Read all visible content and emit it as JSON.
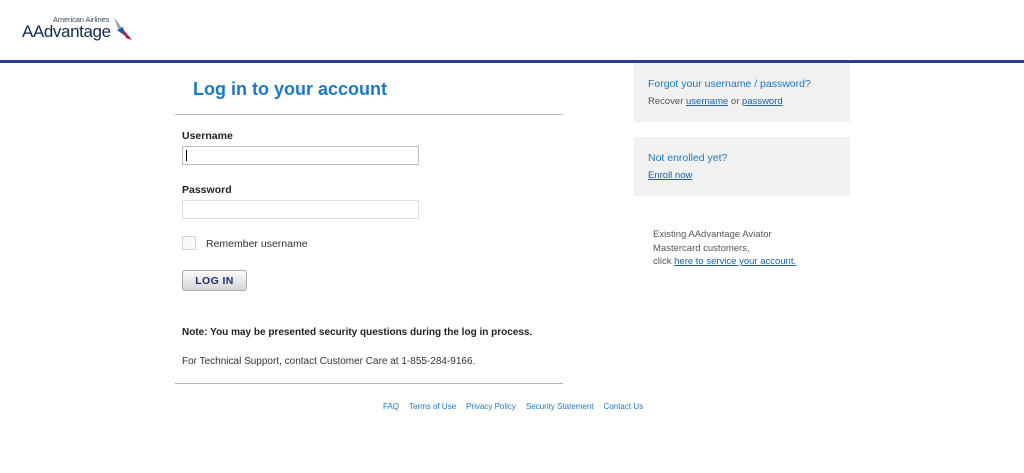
{
  "header": {
    "logo_small": "American Airlines",
    "logo_main": "AAdvantage",
    "colors": {
      "brand_navy": "#0f2a52",
      "bar": "#2b3c8d",
      "accent_red": "#c8102e",
      "accent_blue": "#1a79c7"
    }
  },
  "login": {
    "title": "Log in to your account",
    "username_label": "Username",
    "username_value": "",
    "password_label": "Password",
    "password_value": "",
    "remember_label": "Remember username",
    "remember_checked": false,
    "button_label": "LOG IN",
    "note": "Note: You may be presented security questions during the log in process.",
    "support": "For Technical Support, contact Customer Care at 1-855-284-9166."
  },
  "sidebar": {
    "forgot": {
      "title": "Forgot your username / password?",
      "prefix": "Recover ",
      "username_link": "username",
      "middle": " or ",
      "password_link": "password"
    },
    "enroll": {
      "title": "Not enrolled yet?",
      "link": "Enroll now"
    },
    "aviator": {
      "line1": "Existing AAdvantage Aviator",
      "line2": "Mastercard customers,",
      "line3_prefix": "click ",
      "line3_link": "here to service your account."
    }
  },
  "footer": {
    "links": [
      "FAQ",
      "Terms of Use",
      "Privacy Policy",
      "Security Statement",
      "Contact Us"
    ]
  }
}
